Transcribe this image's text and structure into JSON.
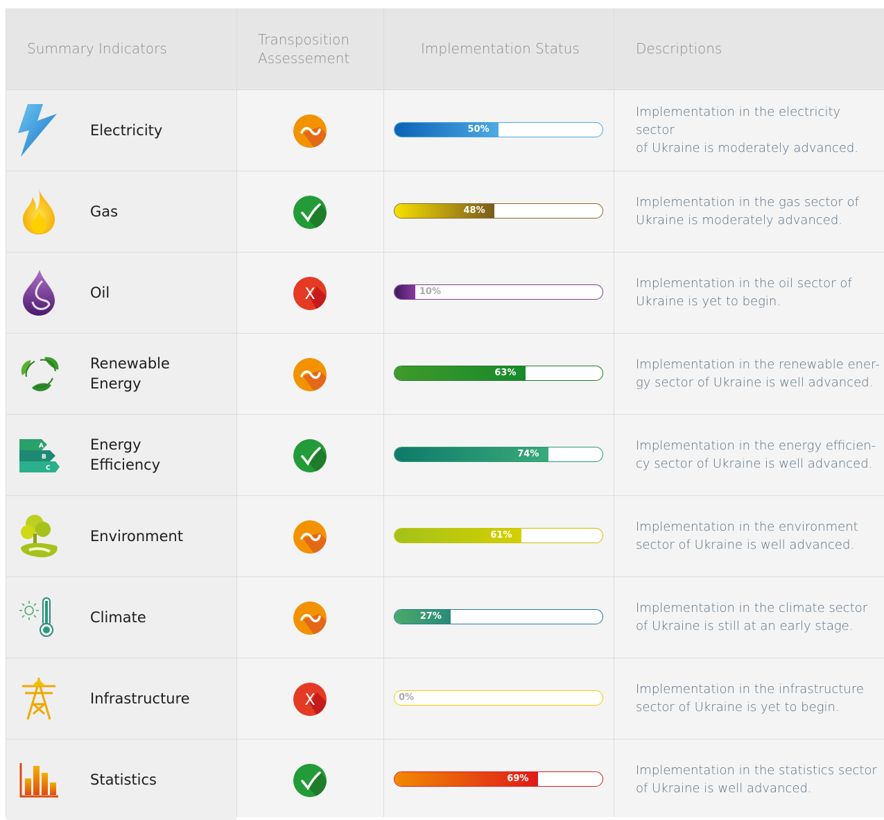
{
  "header": {
    "col_indicators": "Summary Indicators",
    "col_transposition": "Transposition\nAssessement",
    "col_status": "Implementation Status",
    "col_descriptions": "Descriptions"
  },
  "rows": [
    {
      "name": "Electricity",
      "icon": "lightning-icon",
      "assessment": "partial",
      "assessment_symbol": "~",
      "progress": 50,
      "progress_label": "50%",
      "fill_from": "#0a63b4",
      "fill_to": "#4ea9e3",
      "border": "#4aa6e0",
      "label_color": "#ffffff",
      "desc_lines": [
        "Implementation in the electricity sector",
        "of Ukraine is moderately advanced."
      ]
    },
    {
      "name": "Gas",
      "icon": "gas-flame-icon",
      "assessment": "complete",
      "assessment_symbol": "✓",
      "progress": 48,
      "progress_label": "48%",
      "fill_from": "#f6e000",
      "fill_to": "#7a5a1e",
      "border": "#8a6a22",
      "label_color": "#ffffff",
      "desc_lines": [
        "Implementation in the gas sector of",
        "Ukraine is moderately advanced."
      ]
    },
    {
      "name": "Oil",
      "icon": "oil-drop-icon",
      "assessment": "none",
      "assessment_symbol": "X",
      "progress": 10,
      "progress_label": "10%",
      "fill_from": "#3c1a5e",
      "fill_to": "#8a3aa0",
      "border": "#7a3a98",
      "label_color": "#aaaaaa",
      "desc_lines": [
        "Implementation in the oil sector of",
        "Ukraine is yet to begin."
      ]
    },
    {
      "name": "Renewable\nEnergy",
      "icon": "recycle-leaves-icon",
      "assessment": "partial",
      "assessment_symbol": "~",
      "progress": 63,
      "progress_label": "63%",
      "fill_from": "#3f9a2a",
      "fill_to": "#168a2a",
      "border": "#1e7a2a",
      "label_color": "#ffffff",
      "desc_lines": [
        "Implementation in the renewable ener-",
        "gy sector of Ukraine is well advanced."
      ]
    },
    {
      "name": "Energy\nEfficiency",
      "icon": "energy-rating-icon",
      "assessment": "complete",
      "assessment_symbol": "✓",
      "progress": 74,
      "progress_label": "74%",
      "fill_from": "#0f7a6a",
      "fill_to": "#3aaa7a",
      "border": "#2a9a72",
      "label_color": "#ffffff",
      "desc_lines": [
        "Implementation in the energy efficien-",
        "cy sector of Ukraine is well advanced."
      ]
    },
    {
      "name": "Environment",
      "icon": "tree-icon",
      "assessment": "partial",
      "assessment_symbol": "~",
      "progress": 61,
      "progress_label": "61%",
      "fill_from": "#a2c21a",
      "fill_to": "#d4d000",
      "border": "#c8c400",
      "label_color": "#ffffff",
      "desc_lines": [
        "Implementation in the environment",
        "sector of Ukraine is well advanced."
      ]
    },
    {
      "name": "Climate",
      "icon": "thermometer-icon",
      "assessment": "partial",
      "assessment_symbol": "~",
      "progress": 27,
      "progress_label": "27%",
      "fill_from": "#4aaa6a",
      "fill_to": "#2a8a7a",
      "border": "#2a7a8a",
      "label_color": "#ffffff",
      "desc_lines": [
        "Implementation in the climate sector",
        "of Ukraine is still at an early stage."
      ]
    },
    {
      "name": "Infrastructure",
      "icon": "power-tower-icon",
      "assessment": "none",
      "assessment_symbol": "X",
      "progress": 0,
      "progress_label": "0%",
      "fill_from": "#ffffff",
      "fill_to": "#ffffff",
      "border": "#f0d000",
      "label_color": "#aaaaaa",
      "desc_lines": [
        "Implementation in the infrastructure",
        "sector of Ukraine is yet to begin."
      ]
    },
    {
      "name": "Statistics",
      "icon": "bar-chart-icon",
      "assessment": "complete",
      "assessment_symbol": "✓",
      "progress": 69,
      "progress_label": "69%",
      "fill_from": "#f08a00",
      "fill_to": "#e01a1a",
      "border": "#e01a1a",
      "label_color": "#ffffff",
      "desc_lines": [
        "Implementation in the statistics sector",
        "of Ukraine is well advanced."
      ]
    }
  ]
}
